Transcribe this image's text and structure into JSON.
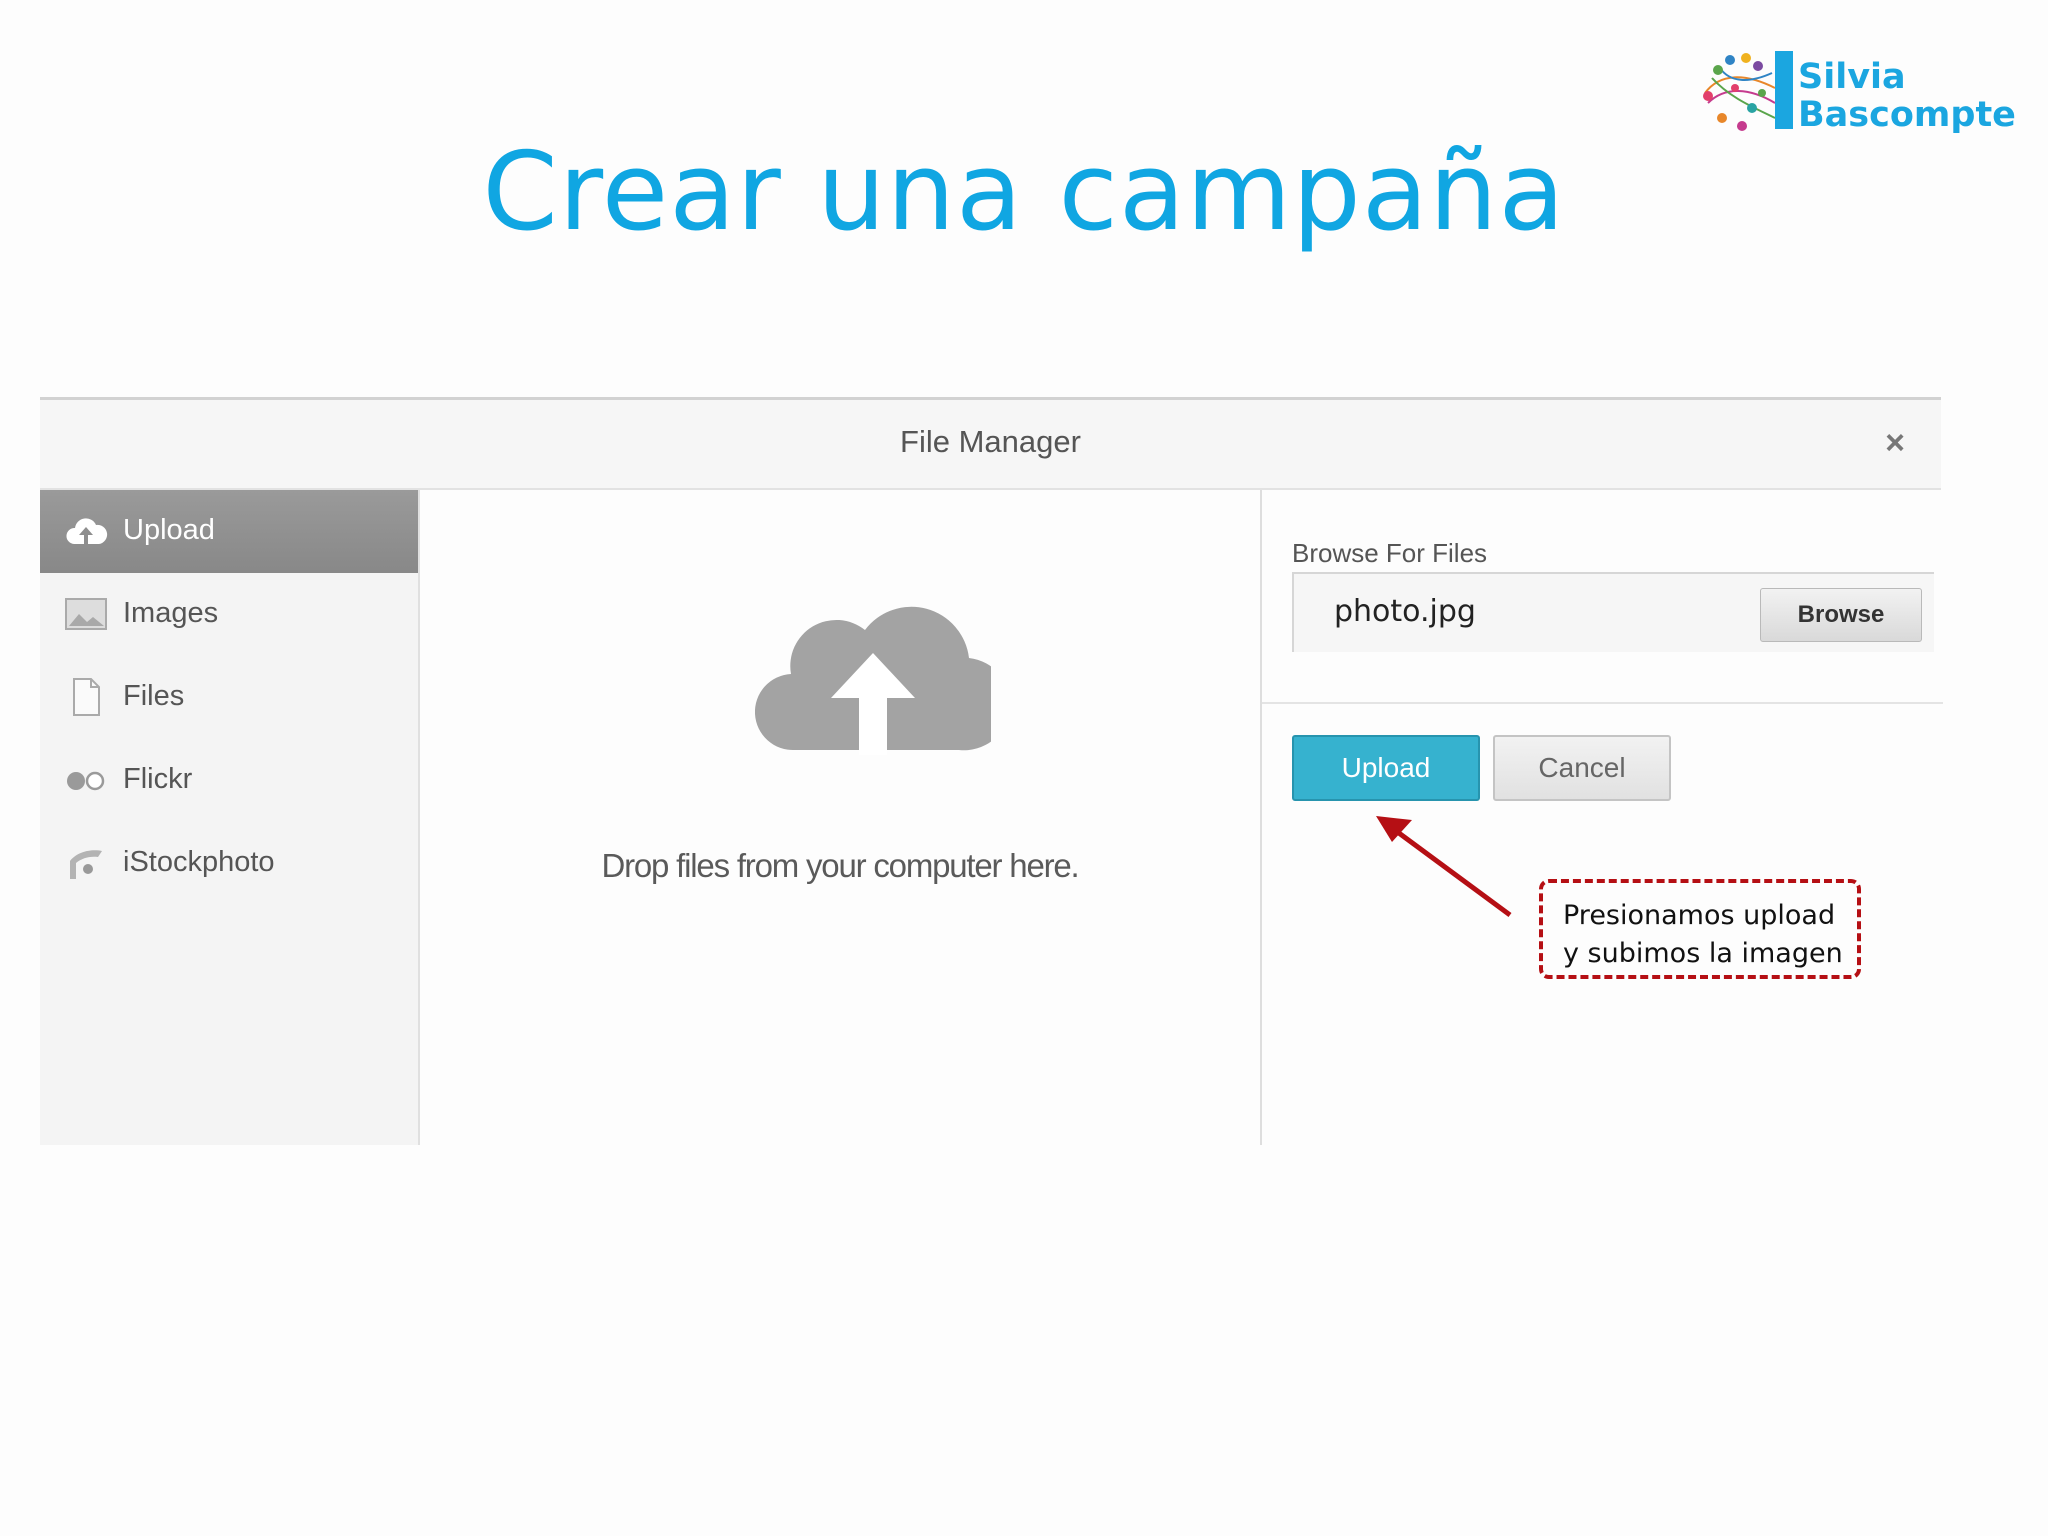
{
  "slide": {
    "title": "Crear una campaña"
  },
  "logo": {
    "line1": "Silvia",
    "line2": "Bascompte"
  },
  "file_manager": {
    "title": "File Manager",
    "close_label": "×",
    "sidebar": {
      "items": [
        {
          "label": "Upload",
          "icon": "cloud-upload-icon",
          "active": true
        },
        {
          "label": "Images",
          "icon": "image-icon",
          "active": false
        },
        {
          "label": "Files",
          "icon": "file-icon",
          "active": false
        },
        {
          "label": "Flickr",
          "icon": "flickr-icon",
          "active": false
        },
        {
          "label": "iStockphoto",
          "icon": "istockphoto-icon",
          "active": false
        }
      ]
    },
    "drop_zone": {
      "icon": "cloud-upload-icon",
      "text": "Drop files from your computer here."
    },
    "browse": {
      "label": "Browse For Files",
      "file_value": "photo.jpg",
      "button_label": "Browse"
    },
    "actions": {
      "upload_label": "Upload",
      "cancel_label": "Cancel"
    }
  },
  "annotation": {
    "line1": "Presionamos upload",
    "line2": "y subimos la imagen",
    "color": "#b50f14"
  },
  "colors": {
    "title": "#10a6e2",
    "upload_button": "#36b2cf"
  }
}
